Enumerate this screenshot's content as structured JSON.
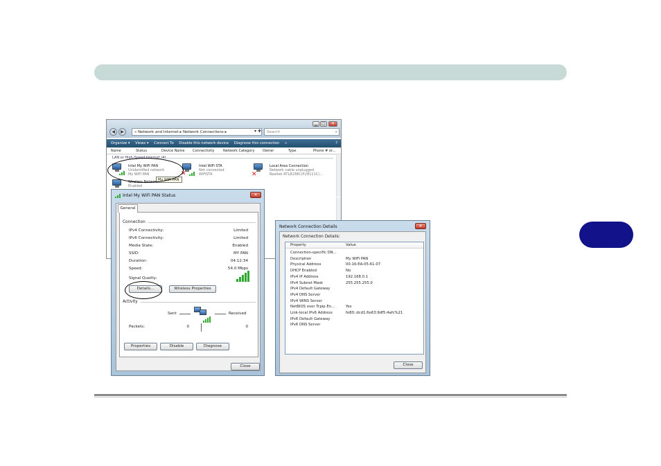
{
  "explorer": {
    "window_buttons": [
      "▁",
      "▢",
      "✕"
    ],
    "nav_back": "◀",
    "nav_forward": "▶",
    "address": "«  Network and Internet  ▸  Network Connections  ▸",
    "address_go": "▾ ✚",
    "search_placeholder": "Search",
    "toolbar": {
      "organize": "Organize ▾",
      "views": "Views ▾",
      "connect_to": "Connect To",
      "disable_device": "Disable this network device",
      "diagnose": "Diagnose this connection",
      "more": "»",
      "help": "?"
    },
    "columns": [
      "Name",
      "Status",
      "Device Name",
      "Connectivity",
      "Network Category",
      "Owner",
      "Type",
      "Phone # or..."
    ],
    "group_label": "LAN or High-Speed Internet (4)",
    "items": [
      {
        "name": "Intel My WiFi PAN",
        "status": "Unidentified network",
        "device": "My WiFi PAN"
      },
      {
        "name": "Intel WiFi STA",
        "status": "Not connected",
        "device": "WiFiSTA"
      },
      {
        "name": "Local Area Connection",
        "status": "Network cable unplugged",
        "device": "Realtek RTL8168C(P)/8111C(..."
      },
      {
        "name": "Wireless Network Connection",
        "status": "Enabled",
        "device": ""
      }
    ],
    "tooltip": "My WiFi PAN"
  },
  "status_dialog": {
    "title": "Intel My WiFi PAN Status",
    "close": "✕",
    "tab": "General",
    "connection_label": "Connection",
    "rows": [
      {
        "label": "IPv4 Connectivity:",
        "value": "Limited"
      },
      {
        "label": "IPv6 Connectivity:",
        "value": "Limited"
      },
      {
        "label": "Media State:",
        "value": "Enabled"
      },
      {
        "label": "SSID:",
        "value": "MY PAN"
      },
      {
        "label": "Duration:",
        "value": "04:12:34"
      },
      {
        "label": "Speed:",
        "value": "54.0 Mbps"
      }
    ],
    "signal_label": "Signal Quality:",
    "details_button": "Details...",
    "wireless_button": "Wireless Properties",
    "activity_label": "Activity",
    "sent_label": "Sent",
    "received_label": "Received",
    "packets_label": "Packets:",
    "packets_sent": "0",
    "packets_received": "0",
    "properties_button": "Properties",
    "disable_button": "Disable",
    "diagnose_button": "Diagnose",
    "close_button": "Close"
  },
  "details_dialog": {
    "title": "Network Connection Details",
    "close": "✕",
    "label": "Network Connection Details:",
    "col_property": "Property",
    "col_value": "Value",
    "rows": [
      {
        "p": "Connection-specific DN...",
        "v": ""
      },
      {
        "p": "Description",
        "v": "My WiFi PAN"
      },
      {
        "p": "Physical Address",
        "v": "00-16-EA-05-61-07"
      },
      {
        "p": "DHCP Enabled",
        "v": "No"
      },
      {
        "p": "IPv4 IP Address",
        "v": "192.168.0.1"
      },
      {
        "p": "IPv4 Subnet Mask",
        "v": "255.255.255.0"
      },
      {
        "p": "IPv4 Default Gateway",
        "v": ""
      },
      {
        "p": "IPv4 DNS Server",
        "v": ""
      },
      {
        "p": "IPv4 WINS Server",
        "v": ""
      },
      {
        "p": "NetBIOS over Tcpip En...",
        "v": "Yes"
      },
      {
        "p": "Link-local IPv6 Address",
        "v": "fe80::dcd1:6e63:9df5:4afc%21"
      },
      {
        "p": "IPv6 Default Gateway",
        "v": ""
      },
      {
        "p": "IPv6 DNS Server",
        "v": ""
      }
    ],
    "close_button": "Close"
  },
  "colors": {
    "header_bar": "#c8dad6",
    "chapter_tab": "#12128a",
    "toolbar": "#2d5a7d",
    "close_red": "#c1392b",
    "signal_green": "#2fa82f"
  }
}
